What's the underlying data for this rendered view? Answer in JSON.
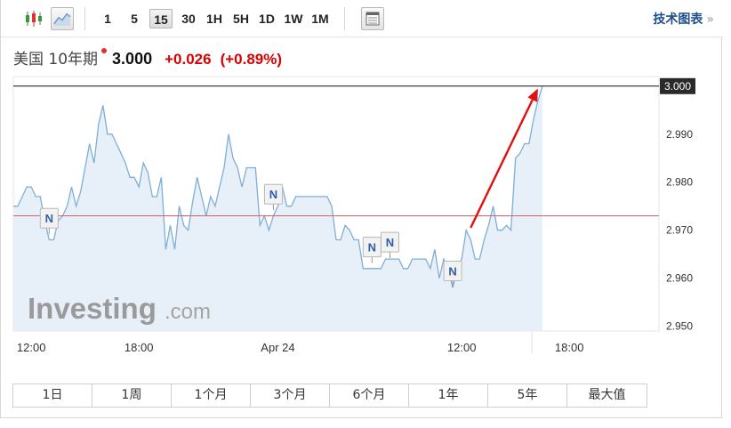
{
  "toolbar": {
    "chart_type_icons": [
      "candlestick-icon",
      "line-chart-icon"
    ],
    "intervals": [
      "1",
      "5",
      "15",
      "30",
      "1H",
      "5H",
      "1D",
      "1W",
      "1M"
    ],
    "active_interval": "15",
    "table_icon": "table-icon",
    "tech_chart_link": "技术图表",
    "tech_chart_arrow": "»"
  },
  "quote": {
    "name": "美国 10年期",
    "price": "3.000",
    "change": "+0.026",
    "change_pct": "(+0.89%)"
  },
  "watermark": {
    "brand_bold": "Investing",
    "brand_light": ".com"
  },
  "colors": {
    "line": "#7faed6",
    "area": "#e3edf7",
    "ref_line": "#e06060",
    "current_line": "#111111",
    "arrow": "#e01010",
    "positive": "#d80000"
  },
  "chart_data": {
    "type": "area",
    "ylim": [
      2.949,
      3.002
    ],
    "yticks": [
      "3.000",
      "2.990",
      "2.980",
      "2.970",
      "2.960",
      "2.950"
    ],
    "xticks": [
      {
        "label": "12:00",
        "x": 0
      },
      {
        "label": "18:00",
        "x": 24
      },
      {
        "label": "Apr 24",
        "x": 55
      },
      {
        "label": "12:00",
        "x": 96
      },
      {
        "label": "18:00",
        "x": 120
      }
    ],
    "xlim": [
      -4,
      140
    ],
    "current_value": 3.0,
    "current_value_label": "3.000",
    "reference_value": 2.973,
    "values": [
      [
        -4,
        2.975
      ],
      [
        -3,
        2.975
      ],
      [
        -2,
        2.977
      ],
      [
        -1,
        2.979
      ],
      [
        0,
        2.979
      ],
      [
        1,
        2.977
      ],
      [
        2,
        2.977
      ],
      [
        3,
        2.972
      ],
      [
        4,
        2.968
      ],
      [
        5,
        2.968
      ],
      [
        6,
        2.972
      ],
      [
        7,
        2.973
      ],
      [
        8,
        2.975
      ],
      [
        9,
        2.979
      ],
      [
        10,
        2.975
      ],
      [
        11,
        2.978
      ],
      [
        12,
        2.983
      ],
      [
        13,
        2.988
      ],
      [
        14,
        2.984
      ],
      [
        15,
        2.992
      ],
      [
        16,
        2.996
      ],
      [
        17,
        2.99
      ],
      [
        18,
        2.99
      ],
      [
        19,
        2.988
      ],
      [
        20,
        2.986
      ],
      [
        21,
        2.984
      ],
      [
        22,
        2.981
      ],
      [
        23,
        2.981
      ],
      [
        24,
        2.979
      ],
      [
        25,
        2.984
      ],
      [
        26,
        2.982
      ],
      [
        27,
        2.977
      ],
      [
        28,
        2.977
      ],
      [
        29,
        2.981
      ],
      [
        30,
        2.966
      ],
      [
        31,
        2.971
      ],
      [
        32,
        2.966
      ],
      [
        33,
        2.975
      ],
      [
        34,
        2.971
      ],
      [
        35,
        2.97
      ],
      [
        36,
        2.976
      ],
      [
        37,
        2.981
      ],
      [
        38,
        2.977
      ],
      [
        39,
        2.973
      ],
      [
        40,
        2.977
      ],
      [
        41,
        2.975
      ],
      [
        42,
        2.979
      ],
      [
        43,
        2.983
      ],
      [
        44,
        2.99
      ],
      [
        45,
        2.985
      ],
      [
        46,
        2.983
      ],
      [
        47,
        2.979
      ],
      [
        48,
        2.983
      ],
      [
        49,
        2.983
      ],
      [
        50,
        2.983
      ],
      [
        51,
        2.971
      ],
      [
        52,
        2.973
      ],
      [
        53,
        2.97
      ],
      [
        54,
        2.973
      ],
      [
        55,
        2.975
      ],
      [
        56,
        2.979
      ],
      [
        57,
        2.975
      ],
      [
        58,
        2.975
      ],
      [
        59,
        2.977
      ],
      [
        60,
        2.977
      ],
      [
        61,
        2.977
      ],
      [
        62,
        2.977
      ],
      [
        63,
        2.977
      ],
      [
        64,
        2.977
      ],
      [
        65,
        2.977
      ],
      [
        66,
        2.977
      ],
      [
        67,
        2.975
      ],
      [
        68,
        2.968
      ],
      [
        69,
        2.968
      ],
      [
        70,
        2.971
      ],
      [
        71,
        2.97
      ],
      [
        72,
        2.968
      ],
      [
        73,
        2.968
      ],
      [
        74,
        2.962
      ],
      [
        75,
        2.962
      ],
      [
        76,
        2.962
      ],
      [
        77,
        2.962
      ],
      [
        78,
        2.962
      ],
      [
        79,
        2.964
      ],
      [
        80,
        2.964
      ],
      [
        81,
        2.964
      ],
      [
        82,
        2.964
      ],
      [
        83,
        2.962
      ],
      [
        84,
        2.962
      ],
      [
        85,
        2.964
      ],
      [
        86,
        2.964
      ],
      [
        87,
        2.964
      ],
      [
        88,
        2.964
      ],
      [
        89,
        2.962
      ],
      [
        90,
        2.966
      ],
      [
        91,
        2.96
      ],
      [
        92,
        2.964
      ],
      [
        93,
        2.962
      ],
      [
        94,
        2.958
      ],
      [
        95,
        2.962
      ],
      [
        96,
        2.964
      ],
      [
        97,
        2.97
      ],
      [
        98,
        2.968
      ],
      [
        99,
        2.964
      ],
      [
        100,
        2.964
      ],
      [
        101,
        2.968
      ],
      [
        102,
        2.971
      ],
      [
        103,
        2.975
      ],
      [
        104,
        2.97
      ],
      [
        105,
        2.97
      ],
      [
        106,
        2.971
      ],
      [
        107,
        2.97
      ],
      [
        108,
        2.985
      ],
      [
        109,
        2.986
      ],
      [
        110,
        2.988
      ],
      [
        111,
        2.988
      ],
      [
        112,
        2.993
      ],
      [
        113,
        2.997
      ],
      [
        114,
        3.0
      ]
    ],
    "news_markers": [
      {
        "label": "N",
        "x": 4,
        "y": 2.9725
      },
      {
        "label": "N",
        "x": 54,
        "y": 2.9775
      },
      {
        "label": "N",
        "x": 76,
        "y": 2.9665
      },
      {
        "label": "N",
        "x": 80,
        "y": 2.9675
      },
      {
        "label": "N",
        "x": 94,
        "y": 2.9615
      }
    ],
    "arrow": {
      "from": [
        98,
        2.9705
      ],
      "to": [
        113,
        2.9995
      ]
    }
  },
  "ranges": [
    "1日",
    "1周",
    "1个月",
    "3个月",
    "6个月",
    "1年",
    "5年",
    "最大值"
  ]
}
